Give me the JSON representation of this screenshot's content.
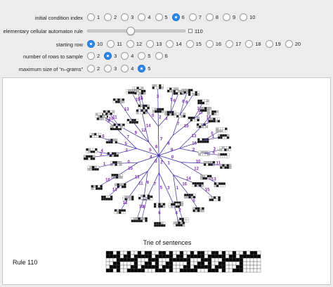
{
  "controls": {
    "initial_condition": {
      "label": "initial condition index",
      "options": [
        "1",
        "2",
        "3",
        "4",
        "5",
        "6",
        "7",
        "8",
        "9",
        "10"
      ],
      "selected": "6"
    },
    "rule": {
      "label": "elementary cellular automaton rule",
      "value": "110",
      "level_fraction": 0.43
    },
    "starting_row": {
      "label": "starting row",
      "options": [
        "10",
        "11",
        "12",
        "13",
        "14",
        "15",
        "16",
        "17",
        "18",
        "19",
        "20"
      ],
      "selected": "10"
    },
    "rows_to_sample": {
      "label": "number of rows to sample",
      "options": [
        "2",
        "3",
        "4",
        "5",
        "6"
      ],
      "selected": "3"
    },
    "max_ngram": {
      "label": "maximum size of “n–grams”",
      "options": [
        "2",
        "3",
        "4",
        "5"
      ],
      "selected": "5"
    }
  },
  "graph": {
    "edge_labels": [
      "0",
      "1",
      "2",
      "3",
      "4",
      "5",
      "6",
      "7",
      "8",
      "9",
      "10",
      "11",
      "12",
      "13",
      "14",
      "15",
      "16"
    ],
    "caption": "Trie of sentences"
  },
  "rule_display": {
    "label": "Rule 110"
  },
  "colors": {
    "accent": "#2f8cf0",
    "edge": "#4b3aa8",
    "edge_label": "#7a2aa8"
  }
}
